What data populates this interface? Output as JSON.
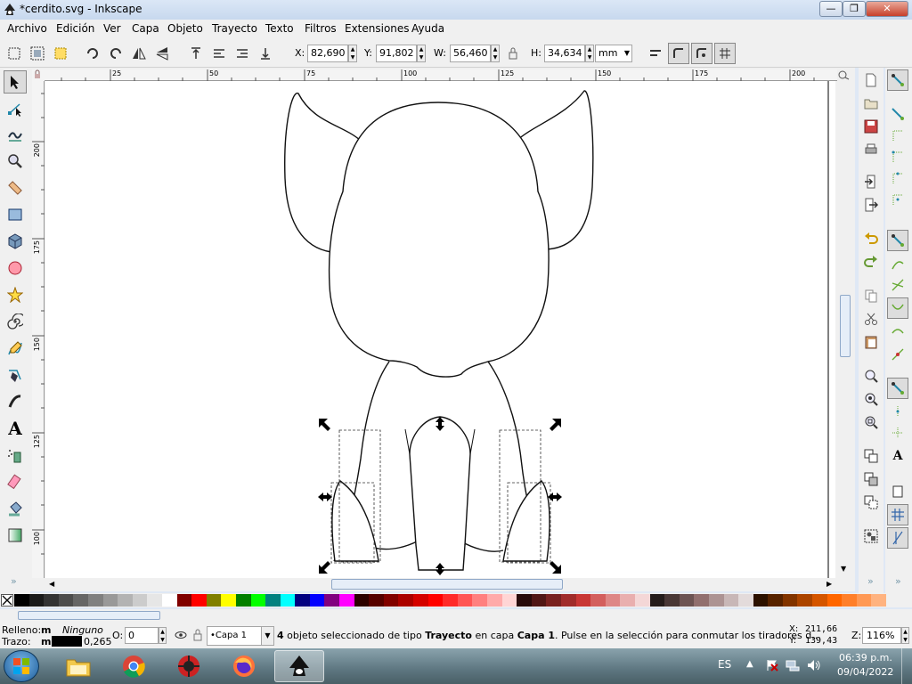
{
  "window": {
    "title": "*cerdito.svg - Inkscape",
    "minimize": "—",
    "restore": "❐",
    "close": "✕"
  },
  "menu": [
    "Archivo",
    "Edición",
    "Ver",
    "Capa",
    "Objeto",
    "Trayecto",
    "Texto",
    "Filtros",
    "Extensiones",
    "Ayuda"
  ],
  "toolbar": {
    "x_label": "X:",
    "x_value": "82,690",
    "y_label": "Y:",
    "y_value": "91,802",
    "w_label": "W:",
    "w_value": "56,460",
    "h_label": "H:",
    "h_value": "34,634",
    "unit": "mm"
  },
  "ruler": {
    "h_ticks": [
      "25",
      "50",
      "75",
      "100",
      "125",
      "150",
      "175",
      "200"
    ],
    "v_ticks": [
      "200",
      "175",
      "150",
      "125",
      "100"
    ]
  },
  "status": {
    "fill_label": "Relleno:",
    "fill_mode": "m",
    "fill_value": "Ninguno",
    "stroke_label": "Trazo:",
    "stroke_mode": "m",
    "stroke_width": "0,265",
    "opacity_label": "O:",
    "opacity_value": "0",
    "layer": "•Capa 1",
    "message_count": "4",
    "message_a": " objeto seleccionado de tipo ",
    "message_type": "Trayecto",
    "message_b": " en capa ",
    "message_layer": "Capa 1",
    "message_c": ". Pulse en la selección para conmutar los tiradores d...",
    "cursor_x_label": "X:",
    "cursor_x": "211,66",
    "cursor_y_label": "Y:",
    "cursor_y": "139,43",
    "zoom_label": "Z:",
    "zoom": "116%"
  },
  "taskbar": {
    "lang": "ES",
    "time": "06:39 p.m.",
    "date": "09/04/2022"
  },
  "palette_colors": [
    "#000000",
    "#1a1a1a",
    "#333333",
    "#4d4d4d",
    "#666666",
    "#808080",
    "#999999",
    "#b3b3b3",
    "#cccccc",
    "#e6e6e6",
    "#ffffff",
    "#800000",
    "#ff0000",
    "#808000",
    "#ffff00",
    "#008000",
    "#00ff00",
    "#008080",
    "#00ffff",
    "#000080",
    "#0000ff",
    "#800080",
    "#ff00ff",
    "#2b0000",
    "#550000",
    "#800000",
    "#aa0000",
    "#d40000",
    "#ff0000",
    "#ff2a2a",
    "#ff5555",
    "#ff8080",
    "#ffaaaa",
    "#ffd5d5",
    "#280b0b",
    "#501616",
    "#782121",
    "#a02c2c",
    "#c83737",
    "#d35f5f",
    "#de8787",
    "#e9afaf",
    "#f4d7d7",
    "#241c1c",
    "#483737",
    "#6c5353",
    "#916f6f",
    "#ac9393",
    "#c8b7b7",
    "#e3dbdb",
    "#2b1100",
    "#552200",
    "#803300",
    "#aa4400",
    "#d45500",
    "#ff6600",
    "#ff7f2a",
    "#ff9955",
    "#ffb380"
  ]
}
